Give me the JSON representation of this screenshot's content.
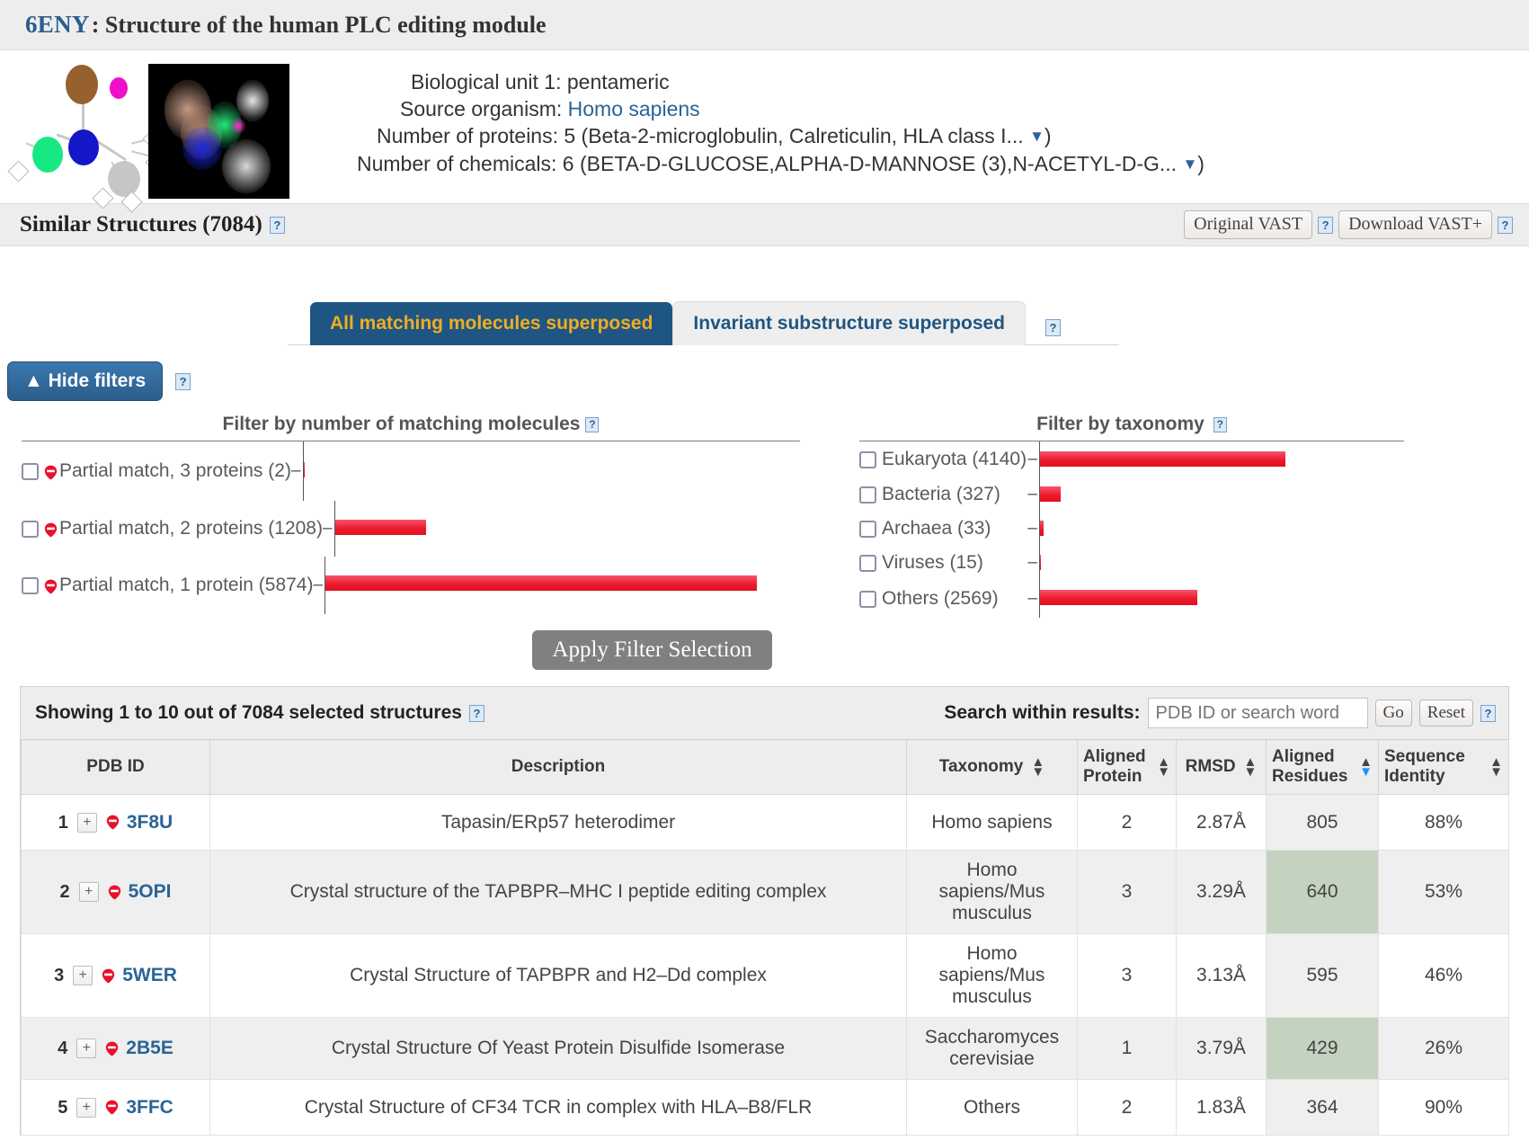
{
  "header": {
    "pdb_id": "6ENY",
    "separator": ": ",
    "title": "Structure of the human PLC editing module"
  },
  "summary": {
    "biological_unit_label": "Biological unit 1: pentameric",
    "source_organism_label": "Source organism: ",
    "source_organism_value": "Homo sapiens",
    "proteins_label": "Number of proteins: 5 (Beta-2-microglobulin, Calreticulin, HLA class I...",
    "proteins_caret": "▼",
    "proteins_close": ")",
    "chemicals_label": "Number of chemicals: 6 (BETA-D-GLUCOSE,ALPHA-D-MANNOSE (3),N-ACETYL-D-G...",
    "chemicals_caret": "▼",
    "chemicals_close": ")"
  },
  "similar_structures": {
    "title": "Similar Structures (7084)",
    "help": "?",
    "original_vast_label": "Original VAST",
    "original_vast_help": "?",
    "download_vast_label": "Download VAST+",
    "download_vast_help": "?"
  },
  "tabs": {
    "items": [
      {
        "label": "All matching molecules superposed",
        "active": true
      },
      {
        "label": "Invariant substructure superposed",
        "active": false
      }
    ],
    "help": "?"
  },
  "filters": {
    "hide_filters_label": "▲ Hide filters",
    "hide_filters_help": "?",
    "apply_label": "Apply Filter Selection"
  },
  "chart_data": [
    {
      "type": "bar",
      "orientation": "horizontal",
      "title": "Filter by number of matching molecules",
      "help": "?",
      "categories": [
        "Partial match, 3 proteins (2)",
        "Partial match, 2 proteins (1208)",
        "Partial match, 1 protein (5874)"
      ],
      "values": [
        2,
        1208,
        5874
      ],
      "xlabel": "",
      "ylabel": "",
      "xlim": [
        0,
        5874
      ],
      "grid": false,
      "legend": "none"
    },
    {
      "type": "bar",
      "orientation": "horizontal",
      "title": "Filter by taxonomy",
      "help": "?",
      "categories": [
        "Eukaryota (4140)",
        "Bacteria (327)",
        "Archaea (33)",
        "Viruses (15)",
        "Others (2569)"
      ],
      "values": [
        4140,
        327,
        33,
        15,
        2569
      ],
      "xlabel": "",
      "ylabel": "",
      "xlim": [
        0,
        4140
      ],
      "grid": false,
      "legend": "none"
    }
  ],
  "results": {
    "showing_text": "Showing 1 to 10 out of 7084 selected structures",
    "showing_help": "?",
    "search_label": "Search within results:",
    "search_placeholder": "PDB ID or search word",
    "search_value": "",
    "go_label": "Go",
    "reset_label": "Reset",
    "search_help": "?",
    "columns": [
      {
        "label": "PDB ID",
        "sortable": false
      },
      {
        "label": "Description",
        "sortable": false
      },
      {
        "label": "Taxonomy",
        "sortable": true,
        "sort": "none"
      },
      {
        "label": "Aligned Protein",
        "sortable": true,
        "sort": "none"
      },
      {
        "label": "RMSD",
        "sortable": true,
        "sort": "none"
      },
      {
        "label": "Aligned Residues",
        "sortable": true,
        "sort": "desc"
      },
      {
        "label": "Sequence Identity",
        "sortable": true,
        "sort": "none"
      }
    ],
    "rows": [
      {
        "num": "1",
        "pdb_id": "3F8U",
        "description": "Tapasin/ERp57 heterodimer",
        "taxonomy": "Homo sapiens",
        "aligned_protein": "2",
        "rmsd": "2.87Å",
        "aligned_residues": "805",
        "sequence_identity": "88%"
      },
      {
        "num": "2",
        "pdb_id": "5OPI",
        "description": "Crystal structure of the TAPBPR–MHC I peptide editing complex",
        "taxonomy": "Homo sapiens/Mus musculus",
        "aligned_protein": "3",
        "rmsd": "3.29Å",
        "aligned_residues": "640",
        "sequence_identity": "53%"
      },
      {
        "num": "3",
        "pdb_id": "5WER",
        "description": "Crystal Structure of TAPBPR and H2–Dd complex",
        "taxonomy": "Homo sapiens/Mus musculus",
        "aligned_protein": "3",
        "rmsd": "3.13Å",
        "aligned_residues": "595",
        "sequence_identity": "46%"
      },
      {
        "num": "4",
        "pdb_id": "2B5E",
        "description": "Crystal Structure Of Yeast Protein Disulfide Isomerase",
        "taxonomy": "Saccharomyces cerevisiae",
        "aligned_protein": "1",
        "rmsd": "3.79Å",
        "aligned_residues": "429",
        "sequence_identity": "26%"
      },
      {
        "num": "5",
        "pdb_id": "3FFC",
        "description": "Crystal Structure of CF34 TCR in complex with HLA–B8/FLR",
        "taxonomy": "Others",
        "aligned_protein": "2",
        "rmsd": "1.83Å",
        "aligned_residues": "364",
        "sequence_identity": "90%"
      }
    ]
  },
  "colors": {
    "brand_blue": "#1f5582",
    "tab_active_text": "#f0ad23",
    "link_blue": "#2a6496",
    "bar_red": "#ec1c2d",
    "highlight_green": "#c3d3bf"
  }
}
